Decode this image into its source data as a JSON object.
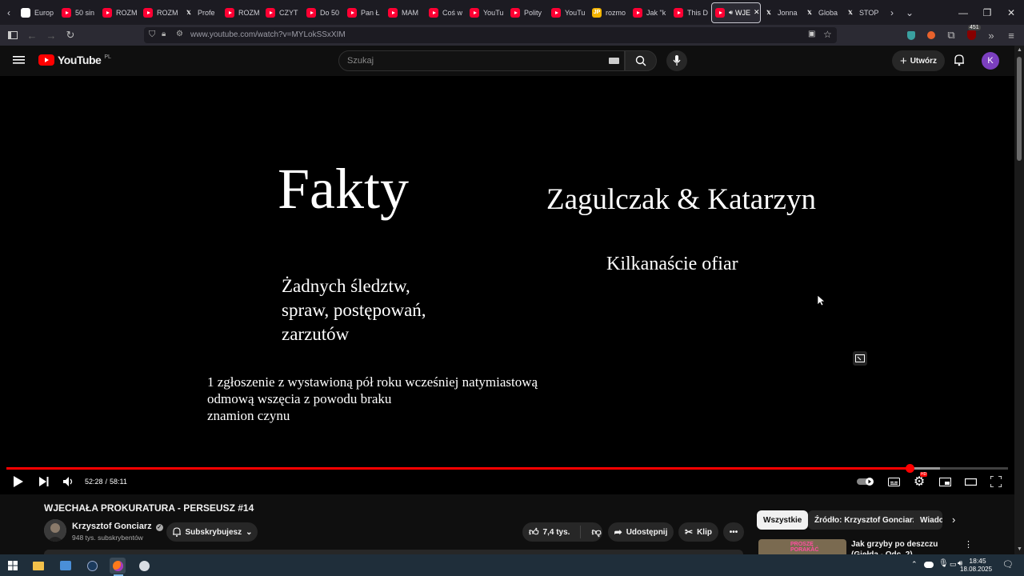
{
  "browser": {
    "tabs": [
      {
        "label": "Europ",
        "icon": "eu-icon"
      },
      {
        "label": "50 sin",
        "icon": "youtube-icon"
      },
      {
        "label": "ROZM",
        "icon": "youtube-icon"
      },
      {
        "label": "ROZM",
        "icon": "youtube-icon"
      },
      {
        "label": "Profe",
        "icon": "x-icon"
      },
      {
        "label": "ROZM",
        "icon": "youtube-icon"
      },
      {
        "label": "CZYT",
        "icon": "youtube-icon"
      },
      {
        "label": "Do 50",
        "icon": "youtube-icon"
      },
      {
        "label": "Pan Ł",
        "icon": "youtube-icon"
      },
      {
        "label": "MAM",
        "icon": "youtube-icon"
      },
      {
        "label": "Coś w",
        "icon": "youtube-icon"
      },
      {
        "label": "YouTu",
        "icon": "youtube-icon"
      },
      {
        "label": "Polity",
        "icon": "youtube-icon"
      },
      {
        "label": "YouTu",
        "icon": "youtube-icon"
      },
      {
        "label": "rozmo",
        "icon": "jp-icon"
      },
      {
        "label": "Jak \"k",
        "icon": "youtube-icon"
      },
      {
        "label": "This D",
        "icon": "youtube-icon"
      },
      {
        "label": "WJE",
        "icon": "youtube-icon",
        "active": true
      },
      {
        "label": "Jonna",
        "icon": "x-icon"
      },
      {
        "label": "Globa",
        "icon": "x-icon"
      },
      {
        "label": "STOP",
        "icon": "x-icon"
      }
    ],
    "url": "www.youtube.com/watch?v=MYLokSSxXIM",
    "extension_badge": "451"
  },
  "youtube": {
    "logo_text": "YouTube",
    "region": "PL",
    "search_placeholder": "Szukaj",
    "create_label": "Utwórz",
    "avatar_letter": "K"
  },
  "video": {
    "slide": {
      "title_left": "Fakty",
      "title_right": "Zagulczak & Katarzyn",
      "subtitle_right": "Kilkanaście ofiar",
      "points_lines": [
        "Żadnych śledztw,",
        "spraw, postępowań,",
        "zarzutów"
      ],
      "note_lines": [
        "1 zgłoszenie z wystawioną pół roku wcześniej natymiastową",
        "odmową wszęcia z powodu braku",
        "znamion czynu"
      ]
    },
    "time_current": "52:28",
    "time_separator": "/",
    "time_total": "58:11",
    "progress_fraction": 0.9018,
    "buffered_fraction": 0.932,
    "hd_badge": "HD"
  },
  "details": {
    "title": "WJECHAŁA PROKURATURA - PERSEUSZ #14",
    "channel_name": "Krzysztof Gonciarz",
    "subscribers": "948 tys. subskrybentów",
    "subscribe_label": "Subskrybujesz",
    "likes": "7,4 tys.",
    "share_label": "Udostępnij",
    "clip_label": "Klip"
  },
  "sidebar": {
    "chips": [
      "Wszystkie",
      "Źródło: Krzysztof Gonciarz",
      "Wiado"
    ],
    "first_video_title": "Jak grzyby po deszczu (Giełda - Odc. 2)",
    "first_video_thumb_text": "PROSZĘ PORAKAĆ"
  },
  "taskbar": {
    "time": "18:45",
    "date": "18.08.2025"
  },
  "colors": {
    "accent": "#ff0000",
    "background": "#0f0f0f",
    "tab_bar": "#1c1b22",
    "taskbar": "#1f2e3a"
  }
}
